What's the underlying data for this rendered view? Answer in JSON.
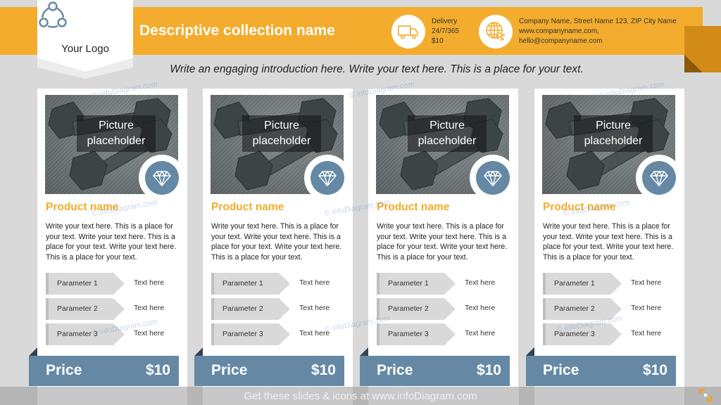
{
  "header": {
    "logo_text": "Your Logo",
    "title": "Descriptive collection name",
    "delivery": {
      "icon": "truck-icon",
      "lines": [
        "Delivery",
        "24/7/365",
        "$10"
      ]
    },
    "contact": {
      "icon": "globe-cursor-icon",
      "lines": [
        "Company Name, Street Name 123, ZIP City Name",
        "www.companyname.com,",
        "hello@companyname.com"
      ]
    }
  },
  "intro": "Write an engaging introduction here. Write your text here. This is a place for your text.",
  "products": [
    {
      "picture_label": [
        "Picture",
        "placeholder"
      ],
      "badge_icon": "diamond-icon",
      "name": "Product name",
      "description": "Write your text here. This is a place for your text. Write your text here. This is a place for your text. Write your text here. This is a place for your text.",
      "params": [
        {
          "label": "Parameter 1",
          "value": "Text here"
        },
        {
          "label": "Parameter 2",
          "value": "Text here"
        },
        {
          "label": "Parameter 3",
          "value": "Text here"
        }
      ],
      "price_label": "Price",
      "price": "$10"
    },
    {
      "picture_label": [
        "Picture",
        "placeholder"
      ],
      "badge_icon": "diamond-icon",
      "name": "Product name",
      "description": "Write your text here. This is a place for your text. Write your text here. This is a place for your text. Write your text here. This is a place for your text.",
      "params": [
        {
          "label": "Parameter 1",
          "value": "Text here"
        },
        {
          "label": "Parameter 2",
          "value": "Text here"
        },
        {
          "label": "Parameter 3",
          "value": "Text here"
        }
      ],
      "price_label": "Price",
      "price": "$10"
    },
    {
      "picture_label": [
        "Picture",
        "placeholder"
      ],
      "badge_icon": "diamond-icon",
      "name": "Product name",
      "description": "Write your text here. This is a place for your text. Write your text here. This is a place for your text. Write your text here. This is a place for your text.",
      "params": [
        {
          "label": "Parameter 1",
          "value": "Text here"
        },
        {
          "label": "Parameter 2",
          "value": "Text here"
        },
        {
          "label": "Parameter 3",
          "value": "Text here"
        }
      ],
      "price_label": "Price",
      "price": "$10"
    },
    {
      "picture_label": [
        "Picture",
        "placeholder"
      ],
      "badge_icon": "diamond-icon",
      "name": "Product name",
      "description": "Write your text here. This is a place for your text. Write your text here. This is a place for your text. Write your text here. This is a place for your text.",
      "params": [
        {
          "label": "Parameter 1",
          "value": "Text here"
        },
        {
          "label": "Parameter 2",
          "value": "Text here"
        },
        {
          "label": "Parameter 3",
          "value": "Text here"
        }
      ],
      "price_label": "Price",
      "price": "$10"
    }
  ],
  "watermark": "© infoDiagram.com",
  "footer": "Get these slides & icons at www.infoDiagram.com",
  "colors": {
    "accent": "#f3ac2d",
    "accent_dark": "#d28b16",
    "steel_blue": "#6589a5",
    "background": "#d9d9d9"
  }
}
